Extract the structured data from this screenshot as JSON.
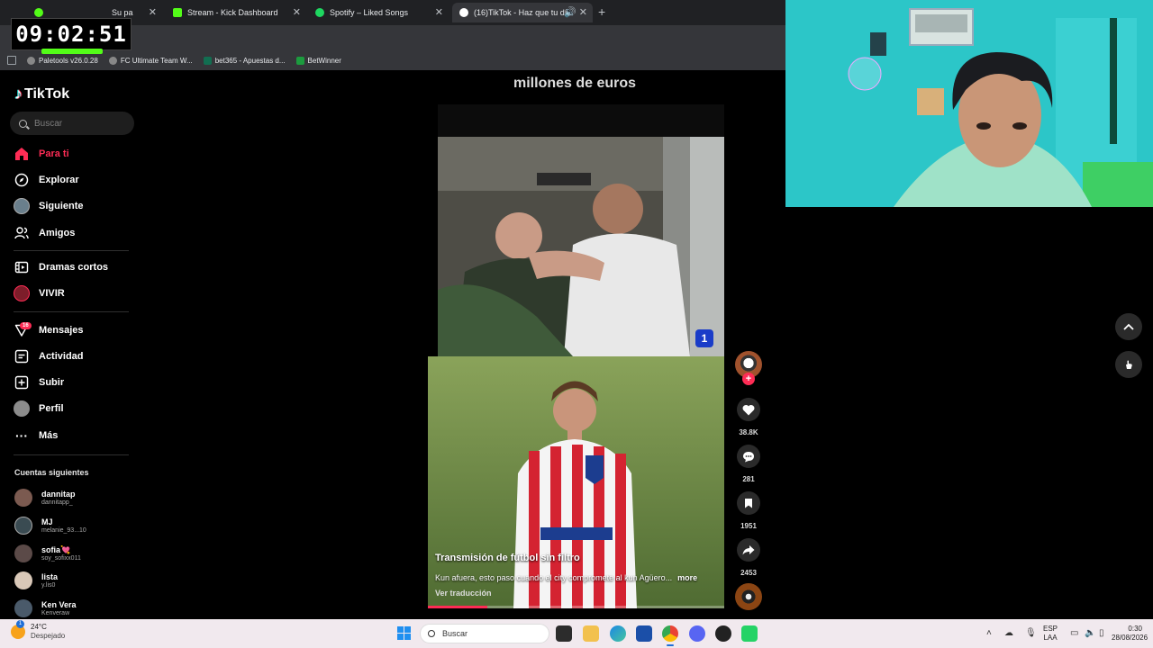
{
  "browser": {
    "tabs": [
      {
        "label": "Stream - Kick Dashboard",
        "favicon_color": "#53fc18"
      },
      {
        "label": "Spotify – Liked Songs",
        "favicon_color": "#1ed760"
      },
      {
        "label": "(16)TikTok - Haz que tu día",
        "favicon_color": "#ffffff"
      }
    ],
    "first_tab_partial": "Su pa",
    "bookmarks": [
      "Paletools v26.0.28",
      "FC Ultimate Team W...",
      "bet365 - Apuestas d...",
      "BetWinner"
    ]
  },
  "overlay": {
    "clock": "09:02:51"
  },
  "sidebar": {
    "logo": "TikTok",
    "search_placeholder": "Buscar",
    "nav": [
      {
        "label": "Para ti",
        "icon": "home-icon"
      },
      {
        "label": "Explorar",
        "icon": "compass-icon"
      },
      {
        "label": "Siguiente",
        "icon": "following-avatar-icon"
      },
      {
        "label": "Amigos",
        "icon": "friends-icon"
      },
      {
        "label": "Dramas cortos",
        "icon": "film-icon"
      },
      {
        "label": "VIVIR",
        "icon": "live-icon"
      },
      {
        "label": "Mensajes",
        "icon": "inbox-icon"
      },
      {
        "label": "Actividad",
        "icon": "activity-icon"
      },
      {
        "label": "Subir",
        "icon": "upload-icon"
      },
      {
        "label": "Perfil",
        "icon": "profile-avatar-icon"
      },
      {
        "label": "Más",
        "icon": "more-icon"
      }
    ],
    "messages_badge": "16",
    "following_title": "Cuentas siguientes",
    "accounts": [
      {
        "name": "dannitap",
        "handle": "dannitapp_"
      },
      {
        "name": "MJ",
        "handle": "melanie_93...10"
      },
      {
        "name": "sofia💘",
        "handle": "soy_sofixx011"
      },
      {
        "name": "lista",
        "handle": "y.lis0"
      },
      {
        "name": "Ken Vera",
        "handle": "Kenveraw"
      }
    ]
  },
  "feed": {
    "top_caption": "millones de euros",
    "tv_logo": "1",
    "video_title": "Transmisión de fútbol sin filtro",
    "video_description": "Kun afuera, esto paso cuando el city compromete al kun Agüero...",
    "more_label": "more",
    "translate_label": "Ver traducción",
    "progress": 0.2,
    "likes": "38.8K",
    "comments": "281",
    "saves": "1951",
    "shares": "2453"
  },
  "taskbar": {
    "weather_temp": "24°C",
    "weather_desc": "Despejado",
    "weather_badge": "1",
    "search_placeholder": "Buscar",
    "lang_top": "ESP",
    "lang_bottom": "LAA",
    "time": "0:30",
    "date": "28/08/2026"
  }
}
